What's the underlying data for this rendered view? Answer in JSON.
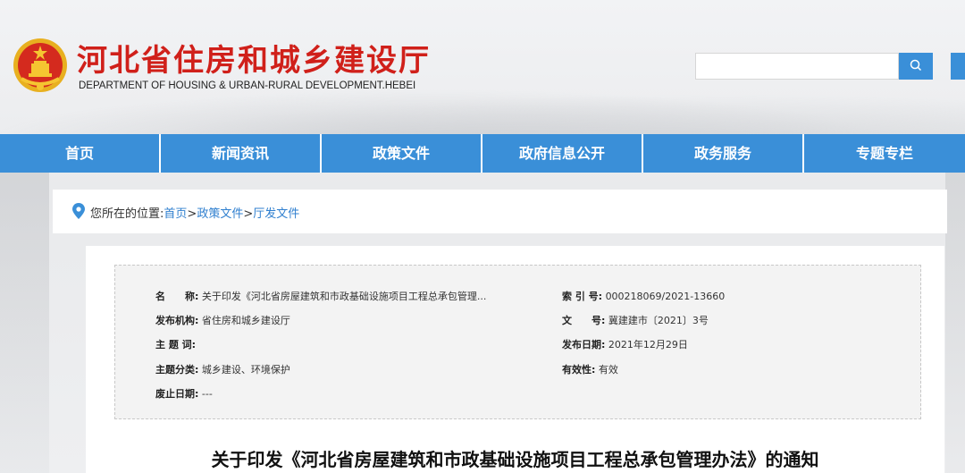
{
  "header": {
    "title": "河北省住房和城乡建设厅",
    "subtitle": "DEPARTMENT OF HOUSING & URBAN-RURAL DEVELOPMENT.HEBEI"
  },
  "search": {
    "value": "",
    "placeholder": ""
  },
  "nav": {
    "items": [
      {
        "label": "首页"
      },
      {
        "label": "新闻资讯"
      },
      {
        "label": "政策文件"
      },
      {
        "label": "政府信息公开"
      },
      {
        "label": "政务服务"
      },
      {
        "label": "专题专栏"
      }
    ]
  },
  "breadcrumb": {
    "prefix": "您所在的位置:",
    "items": [
      "首页",
      "政策文件",
      "厅发文件"
    ],
    "separator": ">"
  },
  "meta": {
    "name_label": "名　　称:",
    "name_value": "关于印发《河北省房屋建筑和市政基础设施项目工程总承包管理...",
    "index_label": "索 引 号:",
    "index_value": "000218069/2021-13660",
    "publisher_label": "发布机构:",
    "publisher_value": "省住房和城乡建设厅",
    "docno_label": "文　　号:",
    "docno_value": "冀建建市〔2021〕3号",
    "keywords_label": "主 题 词:",
    "keywords_value": "",
    "date_label": "发布日期:",
    "date_value": "2021年12月29日",
    "category_label": "主题分类:",
    "category_value": "城乡建设、环境保护",
    "validity_label": "有效性:",
    "validity_value": "有效",
    "abolish_label": "废止日期:",
    "abolish_value": "---"
  },
  "article": {
    "title": "关于印发《河北省房屋建筑和市政基础设施项目工程总承包管理办法》的通知"
  },
  "colors": {
    "brand_red": "#d0201a",
    "nav_blue": "#3a8fd8",
    "link_blue": "#2f7fcf"
  },
  "icons": [
    "national-emblem-icon",
    "search-icon",
    "location-pin-icon"
  ]
}
